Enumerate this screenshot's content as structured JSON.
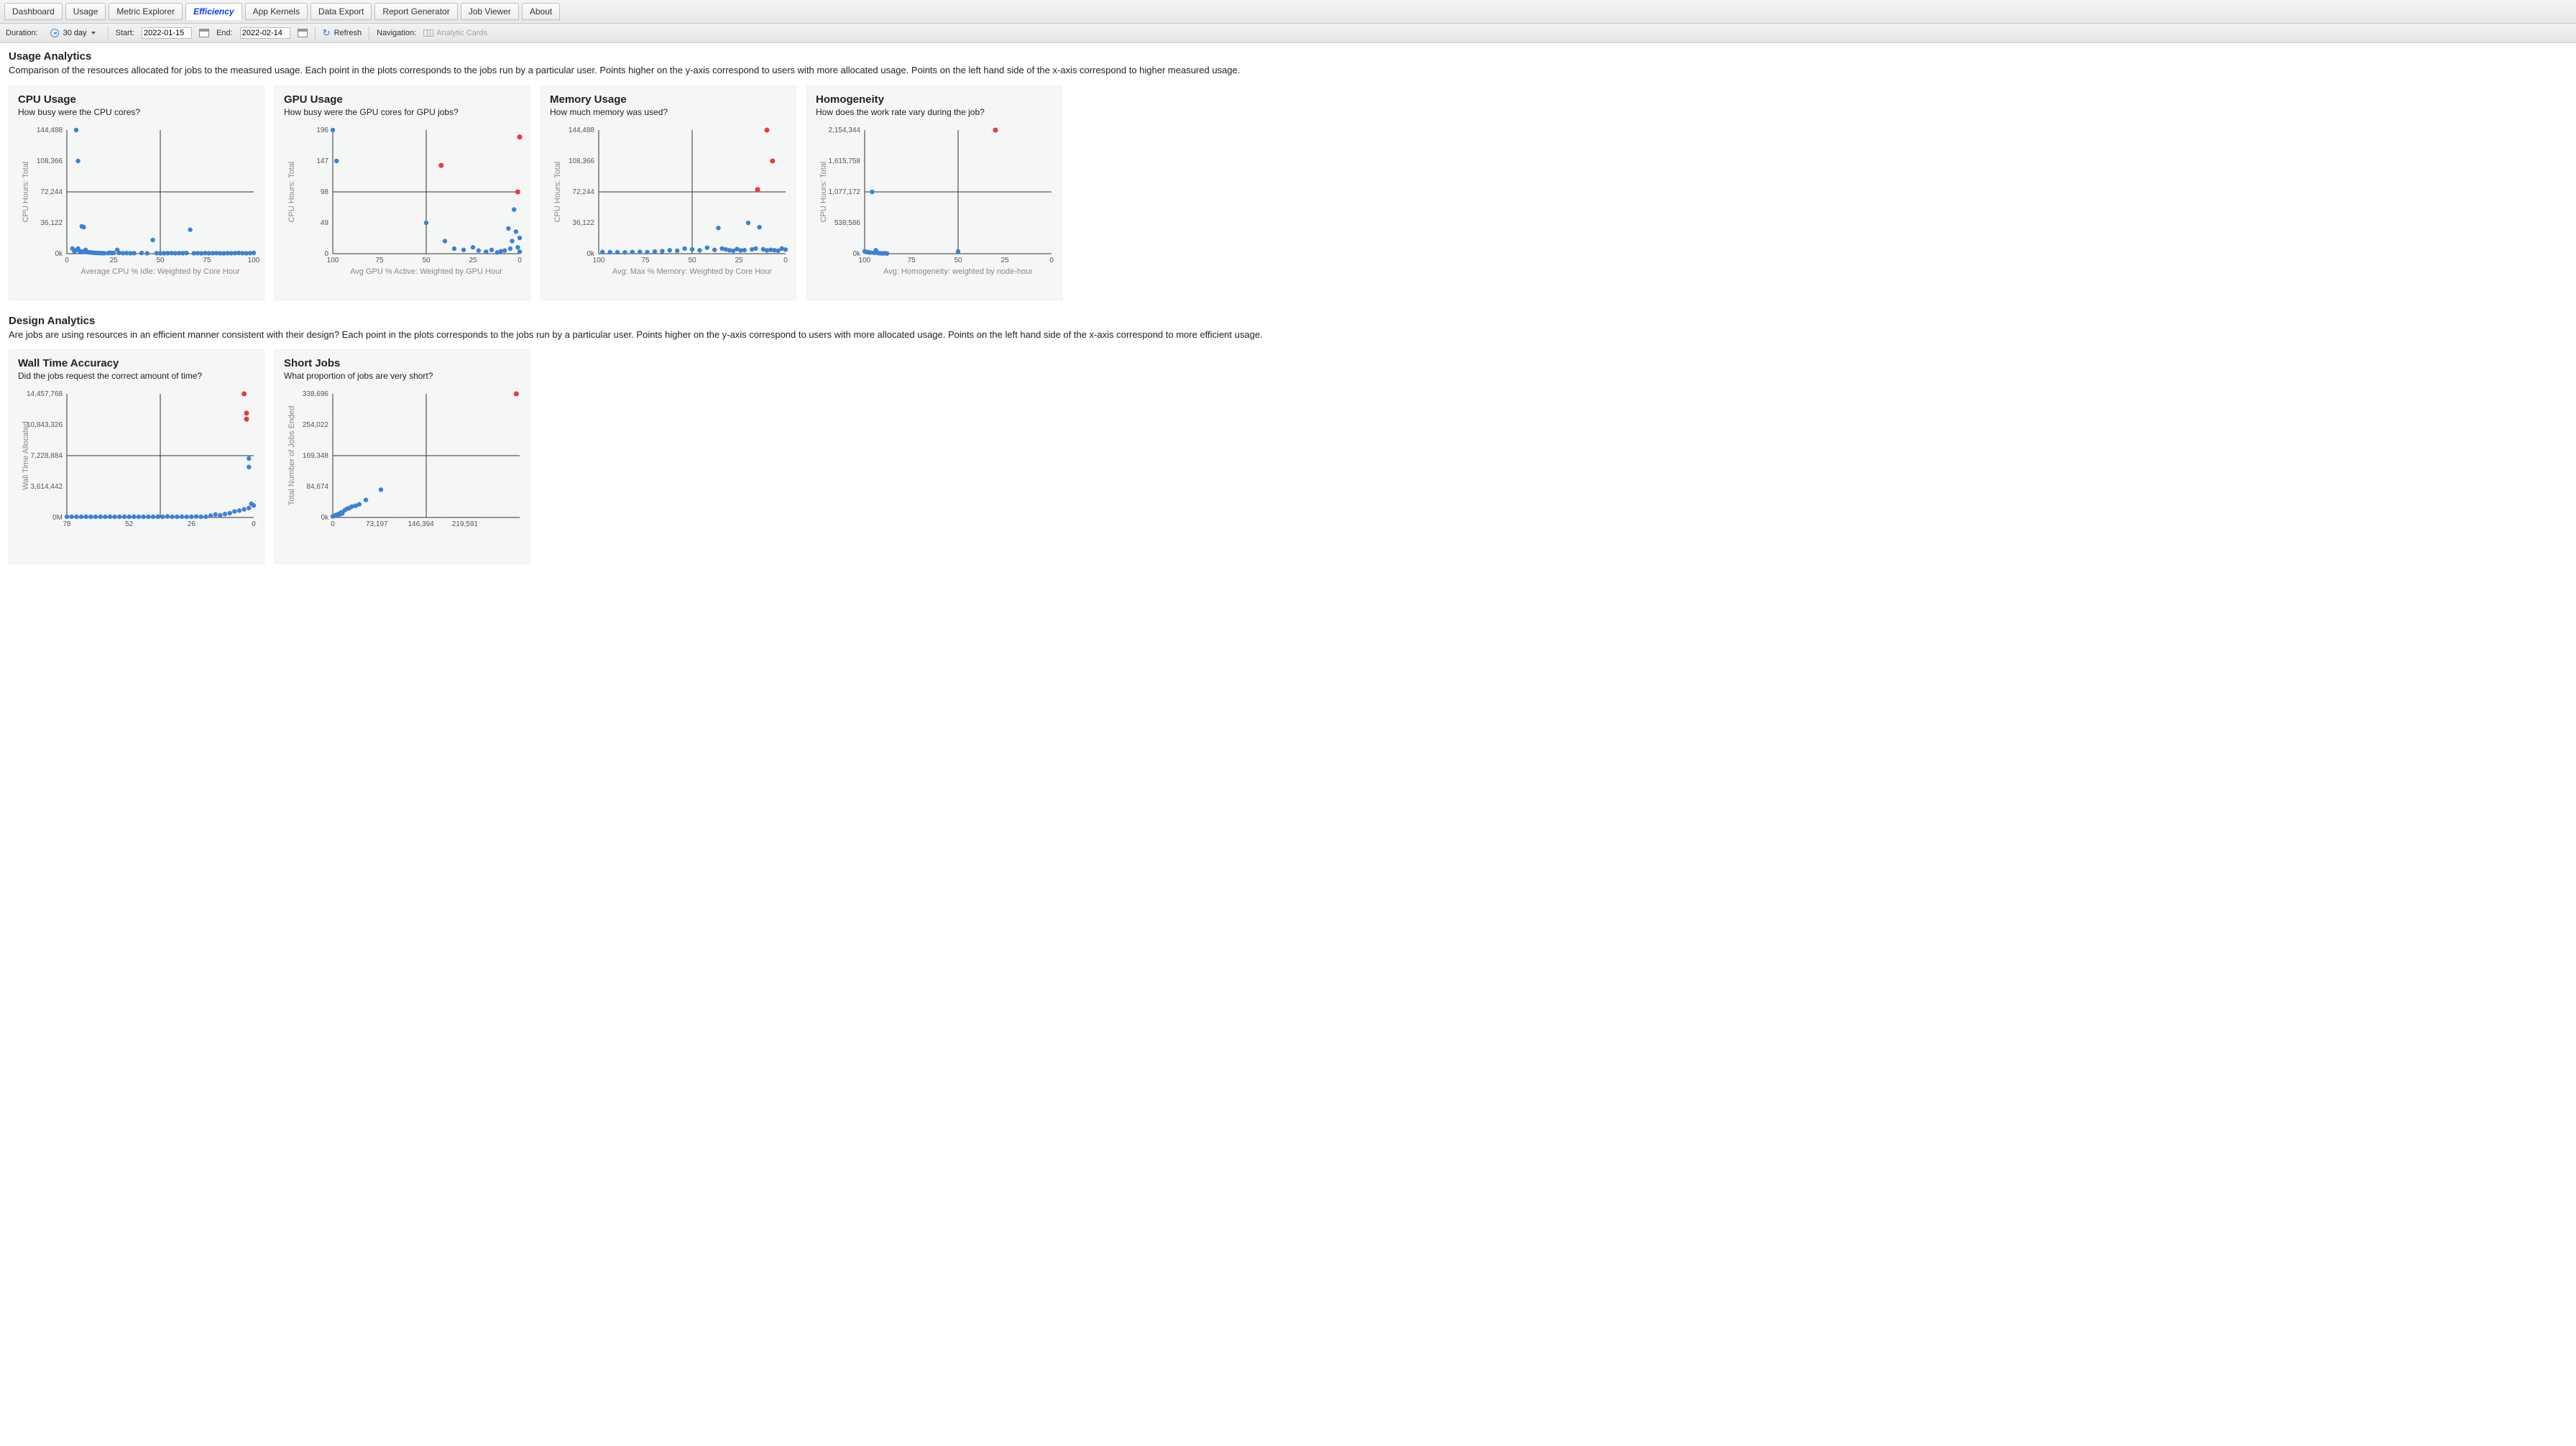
{
  "tabs": {
    "items": [
      {
        "label": "Dashboard"
      },
      {
        "label": "Usage"
      },
      {
        "label": "Metric Explorer"
      },
      {
        "label": "Efficiency"
      },
      {
        "label": "App Kernels"
      },
      {
        "label": "Data Export"
      },
      {
        "label": "Report Generator"
      },
      {
        "label": "Job Viewer"
      },
      {
        "label": "About"
      }
    ],
    "active_index": 3
  },
  "toolbar": {
    "duration_label": "Duration:",
    "duration_value": "30 day",
    "start_label": "Start:",
    "start_value": "2022-01-15",
    "end_label": "End:",
    "end_value": "2022-02-14",
    "refresh_label": "Refresh",
    "nav_label": "Navigation:",
    "nav_link": "Analytic Cards"
  },
  "sections": {
    "usage": {
      "title": "Usage Analytics",
      "desc": "Comparison of the resources allocated for jobs to the measured usage. Each point in the plots corresponds to the jobs run by a particular user. Points higher on the y-axis correspond to users with more allocated usage. Points on the left hand side of the x-axis correspond to higher measured usage."
    },
    "design": {
      "title": "Design Analytics",
      "desc": "Are jobs are using resources in an efficient manner consistent with their design? Each point in the plots corresponds to the jobs run by a particular user. Points higher on the y-axis correspond to users with more allocated usage. Points on the left hand side of the x-axis correspond to more efficient usage."
    }
  },
  "cards": {
    "cpu": {
      "title": "CPU Usage",
      "sub": "How busy were the CPU cores?"
    },
    "gpu": {
      "title": "GPU Usage",
      "sub": "How busy were the GPU cores for GPU jobs?"
    },
    "mem": {
      "title": "Memory Usage",
      "sub": "How much memory was used?"
    },
    "hom": {
      "title": "Homogeneity",
      "sub": "How does the work rate vary during the job?"
    },
    "wall": {
      "title": "Wall Time Accuracy",
      "sub": "Did the jobs request the correct amount of time?"
    },
    "short": {
      "title": "Short Jobs",
      "sub": "What proportion of jobs are very short?"
    }
  },
  "chart_data": [
    {
      "id": "cpu",
      "type": "scatter",
      "xlabel": "Average CPU % Idle: Weighted by Core Hour",
      "ylabel": "CPU Hours: Total",
      "xlim": [
        0,
        100
      ],
      "x_reverse": false,
      "x_cross": 50,
      "ylim": [
        0,
        144488
      ],
      "y_cross": 72244,
      "x_ticks": [
        0,
        25,
        50,
        75,
        100
      ],
      "y_ticks": [
        {
          "v": 0,
          "l": "0k"
        },
        {
          "v": 36122,
          "l": "36,122"
        },
        {
          "v": 72244,
          "l": "72,244"
        },
        {
          "v": 108366,
          "l": "108,366"
        },
        {
          "v": 144488,
          "l": "144,488"
        }
      ],
      "points_blue": [
        [
          5,
          144488
        ],
        [
          6,
          108366
        ],
        [
          8,
          32000
        ],
        [
          9,
          31000
        ],
        [
          3,
          6000
        ],
        [
          4,
          3000
        ],
        [
          5,
          4000
        ],
        [
          6,
          6000
        ],
        [
          7,
          3000
        ],
        [
          8,
          2500
        ],
        [
          9,
          2000
        ],
        [
          10,
          4500
        ],
        [
          11,
          1800
        ],
        [
          12,
          1600
        ],
        [
          13,
          1400
        ],
        [
          14,
          1200
        ],
        [
          15,
          1000
        ],
        [
          16,
          900
        ],
        [
          17,
          800
        ],
        [
          18,
          700
        ],
        [
          19,
          600
        ],
        [
          20,
          500
        ],
        [
          22,
          600
        ],
        [
          23,
          1200
        ],
        [
          24,
          700
        ],
        [
          25,
          900
        ],
        [
          27,
          4500
        ],
        [
          28,
          1000
        ],
        [
          30,
          600
        ],
        [
          32,
          700
        ],
        [
          34,
          500
        ],
        [
          36,
          600
        ],
        [
          40,
          800
        ],
        [
          43,
          500
        ],
        [
          46,
          16000
        ],
        [
          48,
          600
        ],
        [
          50,
          400
        ],
        [
          52,
          500
        ],
        [
          54,
          600
        ],
        [
          56,
          700
        ],
        [
          58,
          500
        ],
        [
          60,
          700
        ],
        [
          62,
          600
        ],
        [
          64,
          800
        ],
        [
          66,
          28000
        ],
        [
          68,
          500
        ],
        [
          70,
          600
        ],
        [
          72,
          400
        ],
        [
          74,
          700
        ],
        [
          76,
          500
        ],
        [
          78,
          600
        ],
        [
          80,
          700
        ],
        [
          82,
          500
        ],
        [
          84,
          400
        ],
        [
          86,
          600
        ],
        [
          88,
          500
        ],
        [
          90,
          700
        ],
        [
          92,
          800
        ],
        [
          94,
          600
        ],
        [
          96,
          500
        ],
        [
          98,
          700
        ],
        [
          100,
          900
        ]
      ],
      "points_red": []
    },
    {
      "id": "gpu",
      "type": "scatter",
      "xlabel": "Avg GPU % Active: Weighted by GPU Hour",
      "ylabel": "CPU Hours: Total",
      "x_reverse": true,
      "xlim": [
        0,
        100
      ],
      "x_cross": 50,
      "ylim": [
        0,
        196
      ],
      "y_cross": 98,
      "x_ticks": [
        100,
        75,
        50,
        25,
        0
      ],
      "y_ticks": [
        {
          "v": 0,
          "l": "0"
        },
        {
          "v": 49,
          "l": "49"
        },
        {
          "v": 98,
          "l": "98"
        },
        {
          "v": 147,
          "l": "147"
        },
        {
          "v": 196,
          "l": "196"
        }
      ],
      "points_blue": [
        [
          100,
          196
        ],
        [
          98,
          147
        ],
        [
          50,
          49
        ],
        [
          40,
          20
        ],
        [
          35,
          8
        ],
        [
          30,
          6
        ],
        [
          25,
          10
        ],
        [
          22,
          5
        ],
        [
          18,
          3
        ],
        [
          15,
          6
        ],
        [
          12,
          2
        ],
        [
          10,
          4
        ],
        [
          8,
          5
        ],
        [
          6,
          40
        ],
        [
          5,
          8
        ],
        [
          4,
          20
        ],
        [
          3,
          70
        ],
        [
          2,
          35
        ],
        [
          1,
          10
        ],
        [
          0,
          25
        ],
        [
          0,
          3
        ]
      ],
      "points_red": [
        [
          42,
          140
        ],
        [
          1,
          98
        ],
        [
          0,
          185
        ]
      ]
    },
    {
      "id": "mem",
      "type": "scatter",
      "xlabel": "Avg: Max % Memory: Weighted by Core Hour",
      "ylabel": "CPU Hours: Total",
      "x_reverse": true,
      "xlim": [
        0,
        100
      ],
      "x_cross": 50,
      "ylim": [
        0,
        144488
      ],
      "y_cross": 72244,
      "x_ticks": [
        100,
        75,
        50,
        25,
        0
      ],
      "y_ticks": [
        {
          "v": 0,
          "l": "0k"
        },
        {
          "v": 36122,
          "l": "36,122"
        },
        {
          "v": 72244,
          "l": "72,244"
        },
        {
          "v": 108366,
          "l": "108,366"
        },
        {
          "v": 144488,
          "l": "144,488"
        }
      ],
      "points_blue": [
        [
          98,
          2000
        ],
        [
          94,
          1800
        ],
        [
          90,
          1700
        ],
        [
          86,
          1600
        ],
        [
          82,
          2000
        ],
        [
          78,
          2200
        ],
        [
          74,
          1800
        ],
        [
          70,
          2500
        ],
        [
          66,
          3000
        ],
        [
          62,
          4000
        ],
        [
          58,
          3500
        ],
        [
          54,
          6000
        ],
        [
          50,
          5000
        ],
        [
          46,
          4000
        ],
        [
          42,
          7000
        ],
        [
          38,
          4500
        ],
        [
          36,
          30000
        ],
        [
          34,
          6000
        ],
        [
          32,
          5000
        ],
        [
          30,
          4000
        ],
        [
          28,
          3500
        ],
        [
          26,
          5500
        ],
        [
          24,
          3800
        ],
        [
          22,
          4200
        ],
        [
          20,
          36000
        ],
        [
          18,
          5000
        ],
        [
          16,
          6000
        ],
        [
          14,
          31000
        ],
        [
          12,
          5200
        ],
        [
          10,
          3800
        ],
        [
          8,
          4500
        ],
        [
          6,
          4000
        ],
        [
          4,
          3500
        ],
        [
          2,
          6000
        ],
        [
          0,
          4800
        ]
      ],
      "points_red": [
        [
          10,
          144488
        ],
        [
          7,
          108366
        ],
        [
          15,
          75000
        ]
      ]
    },
    {
      "id": "hom",
      "type": "scatter",
      "xlabel": "Avg: Homogeneity: weighted by node-hour",
      "ylabel": "CPU Hours: Total",
      "x_reverse": true,
      "xlim": [
        0,
        100
      ],
      "x_cross": 50,
      "ylim": [
        0,
        2154344
      ],
      "y_cross": 1077172,
      "x_ticks": [
        100,
        75,
        50,
        25,
        0
      ],
      "y_ticks": [
        {
          "v": 0,
          "l": "0k"
        },
        {
          "v": 538586,
          "l": "538,586"
        },
        {
          "v": 1077172,
          "l": "1,077,172"
        },
        {
          "v": 1615758,
          "l": "1,615,758"
        },
        {
          "v": 2154344,
          "l": "2,154,344"
        }
      ],
      "points_blue": [
        [
          100,
          40000
        ],
        [
          99,
          30000
        ],
        [
          98,
          25000
        ],
        [
          97,
          20000
        ],
        [
          96,
          1077172
        ],
        [
          95,
          15000
        ],
        [
          94,
          60000
        ],
        [
          93,
          12000
        ],
        [
          92,
          8000
        ],
        [
          91,
          5000
        ],
        [
          90,
          6000
        ],
        [
          89,
          7000
        ],
        [
          88,
          4000
        ],
        [
          50,
          40000
        ]
      ],
      "points_red": [
        [
          30,
          2154344
        ]
      ]
    },
    {
      "id": "wall",
      "type": "scatter",
      "xlabel": "",
      "ylabel": "Wall Time Allocated",
      "x_reverse": true,
      "xlim": [
        0,
        78
      ],
      "x_cross": 39,
      "ylim": [
        0,
        14457768
      ],
      "y_cross": 7228884,
      "x_ticks": [
        78,
        52,
        26,
        0
      ],
      "y_ticks": [
        {
          "v": 0,
          "l": "0M"
        },
        {
          "v": 3614442,
          "l": "3,614,442"
        },
        {
          "v": 7228884,
          "l": "7,228,884"
        },
        {
          "v": 10843326,
          "l": "10,843,326"
        },
        {
          "v": 14457768,
          "l": "14,457,768"
        }
      ],
      "points_blue": [
        [
          78,
          80000
        ],
        [
          76,
          80000
        ],
        [
          74,
          80000
        ],
        [
          72,
          80000
        ],
        [
          70,
          80000
        ],
        [
          68,
          80000
        ],
        [
          66,
          80000
        ],
        [
          64,
          80000
        ],
        [
          62,
          80000
        ],
        [
          60,
          80000
        ],
        [
          58,
          80000
        ],
        [
          56,
          80000
        ],
        [
          54,
          80000
        ],
        [
          52,
          80000
        ],
        [
          50,
          80000
        ],
        [
          48,
          80000
        ],
        [
          46,
          80000
        ],
        [
          44,
          80000
        ],
        [
          42,
          80000
        ],
        [
          40,
          80000
        ],
        [
          38,
          80000
        ],
        [
          36,
          120000
        ],
        [
          34,
          80000
        ],
        [
          32,
          80000
        ],
        [
          30,
          80000
        ],
        [
          28,
          80000
        ],
        [
          26,
          80000
        ],
        [
          24,
          120000
        ],
        [
          22,
          80000
        ],
        [
          20,
          80000
        ],
        [
          18,
          200000
        ],
        [
          16,
          350000
        ],
        [
          14,
          250000
        ],
        [
          12,
          400000
        ],
        [
          10,
          500000
        ],
        [
          8,
          700000
        ],
        [
          6,
          800000
        ],
        [
          4,
          950000
        ],
        [
          2,
          1100000
        ],
        [
          1,
          1600000
        ],
        [
          0,
          1400000
        ],
        [
          2,
          6900000
        ],
        [
          2,
          5900000
        ]
      ],
      "points_red": [
        [
          4,
          14457768
        ],
        [
          3,
          12200000
        ],
        [
          3,
          11500000
        ]
      ]
    },
    {
      "id": "short",
      "type": "scatter",
      "xlabel": "",
      "ylabel": "Total Number of Jobs Ended",
      "x_reverse": false,
      "xlim": [
        0,
        310501
      ],
      "x_cross": 155250,
      "ylim": [
        0,
        338696
      ],
      "y_cross": 169348,
      "x_ticks": [
        0,
        73197,
        146394,
        219591
      ],
      "y_ticks": [
        {
          "v": 0,
          "l": "0k"
        },
        {
          "v": 84674,
          "l": "84,674"
        },
        {
          "v": 169348,
          "l": "169,348"
        },
        {
          "v": 254022,
          "l": "254,022"
        },
        {
          "v": 338696,
          "l": "338,696"
        }
      ],
      "points_blue": [
        [
          0,
          3000
        ],
        [
          2000,
          4000
        ],
        [
          4000,
          5000
        ],
        [
          6000,
          7000
        ],
        [
          8000,
          6000
        ],
        [
          10000,
          10000
        ],
        [
          12000,
          9000
        ],
        [
          14000,
          14000
        ],
        [
          16000,
          11000
        ],
        [
          20000,
          20000
        ],
        [
          24000,
          24000
        ],
        [
          28000,
          26000
        ],
        [
          32000,
          30000
        ],
        [
          38000,
          32000
        ],
        [
          44000,
          36000
        ],
        [
          55000,
          48000
        ],
        [
          80000,
          76000
        ]
      ],
      "points_red": [
        [
          305000,
          338696
        ]
      ]
    }
  ]
}
